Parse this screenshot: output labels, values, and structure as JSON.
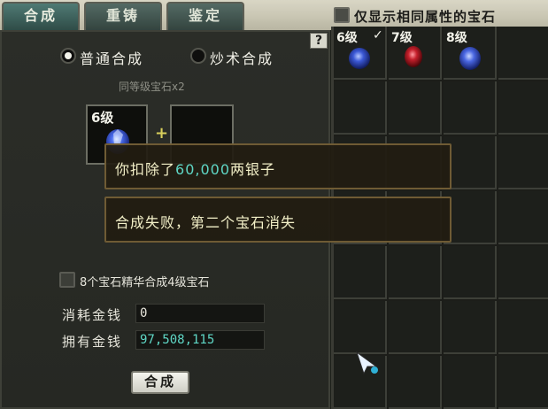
{
  "tabs": [
    {
      "label": "合成",
      "active": true
    },
    {
      "label": "重铸",
      "active": false
    },
    {
      "label": "鉴定",
      "active": false
    }
  ],
  "filter": {
    "label": "仅显示相同属性的宝石",
    "checked": false
  },
  "help_label": "?",
  "modes": [
    {
      "label": "普通合成",
      "selected": true
    },
    {
      "label": "炒术合成",
      "selected": false
    }
  ],
  "subtitle": "同等级宝石x2",
  "slots": [
    {
      "level": "6级",
      "gem_color": "blue"
    },
    {
      "level": "",
      "gem_color": ""
    }
  ],
  "plus": "+",
  "essence_option": {
    "label": "8个宝石精华合成4级宝石",
    "checked": false
  },
  "fields": {
    "cost_label": "消耗金钱",
    "cost_value": "0",
    "owned_label": "拥有金钱",
    "owned_value": "97,508,115"
  },
  "compose_button": "合成",
  "inventory": [
    {
      "level": "6级",
      "check": "✓",
      "gem_color": "blue"
    },
    {
      "level": "7级",
      "check": "",
      "gem_color": "red"
    },
    {
      "level": "8级",
      "check": "",
      "gem_color": "blue"
    }
  ],
  "messages": {
    "deduct_prefix": "你扣除了",
    "deduct_amount": "60,000",
    "deduct_suffix": "两银子",
    "failure": "合成失败，第二个宝石消失"
  },
  "colors": {
    "highlight": "#5fd7c6",
    "accent_tab": "#3e6660",
    "message_border": "#6f5b34"
  }
}
